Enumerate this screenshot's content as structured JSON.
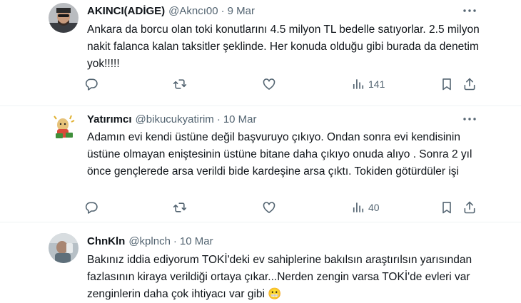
{
  "tweets": [
    {
      "name": "AKINCI(ADİGE)",
      "handle": "@Akncı00",
      "date": "9 Mar",
      "text": "Ankara da borcu olan toki konutlarını 4.5 milyon TL bedelle satıyorlar. 2.5 milyon nakit falanca kalan taksitler şeklinde. Her konuda olduğu gibi burada da denetim yok!!!!!",
      "views": "141"
    },
    {
      "name": "Yatırımcı",
      "handle": "@bikucukyatirim",
      "date": "10 Mar",
      "text": "Adamın evi kendi üstüne değil başvuruyo çıkıyo. Ondan sonra evi kendisinin üstüne olmayan eniştesinin üstüne bitane daha çıkıyo onuda alıyo . Sonra 2 yıl önce gençlerede arsa verildi bide kardeşine arsa çıktı. Tokiden götürdüler işi",
      "views": "40"
    },
    {
      "name": "ChnKln",
      "handle": "@kplnch",
      "date": "10 Mar",
      "text": "Bakınız iddia ediyorum TOKİ'deki ev sahiplerine bakılsın araştırılsın yarısından fazlasının kiraya verildiği ortaya çıkar...Nerden zengin varsa TOKİ'de evleri var zenginlerin daha çok ihtiyacı var gibi",
      "emoji": "😬"
    }
  ],
  "separator": "·",
  "icons": {
    "reply": "reply-icon",
    "retweet": "retweet-icon",
    "like": "like-icon",
    "views": "views-icon",
    "bookmark": "bookmark-icon",
    "share": "share-icon",
    "more": "more-icon"
  },
  "colors": {
    "text": "#0f1419",
    "secondary": "#536471",
    "divider": "#eff3f4"
  }
}
